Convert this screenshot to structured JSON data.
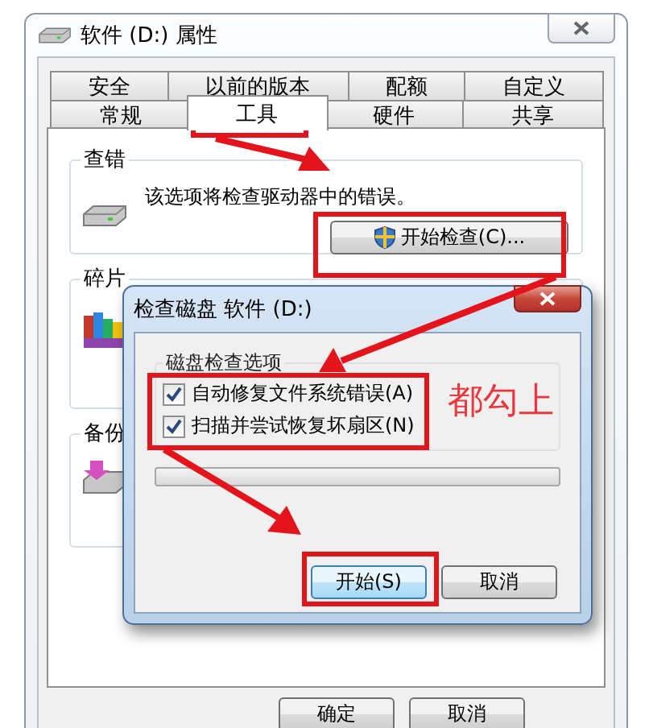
{
  "window": {
    "title": "软件 (D:) 属性"
  },
  "tabs_row_1": [
    {
      "label": "安全",
      "selected": false
    },
    {
      "label": "以前的版本",
      "selected": false
    },
    {
      "label": "配额",
      "selected": false
    },
    {
      "label": "自定义",
      "selected": false
    }
  ],
  "tabs_row_2": [
    {
      "label": "常规",
      "selected": false
    },
    {
      "label": "工具",
      "selected": true
    },
    {
      "label": "硬件",
      "selected": false
    },
    {
      "label": "共享",
      "selected": false
    }
  ],
  "error_check": {
    "title": "查错",
    "description": "该选项将检查驱动器中的错误。",
    "button": "开始检查(C)..."
  },
  "defrag": {
    "title": "碎片"
  },
  "backup": {
    "title": "备份"
  },
  "footer_buttons": [
    "确定",
    "取消"
  ],
  "dialog": {
    "title": "检查磁盘 软件 (D:)",
    "group": "磁盘检查选项",
    "options": [
      {
        "label": "自动修复文件系统错误(A)",
        "checked": true
      },
      {
        "label": "扫描并尝试恢复坏扇区(N)",
        "checked": true
      }
    ],
    "progress": {
      "level": 0
    },
    "buttons": [
      {
        "label": "开始(S)",
        "default": true
      },
      {
        "label": "取消",
        "default": false
      }
    ]
  },
  "annotation": {
    "text": "都勾上"
  }
}
